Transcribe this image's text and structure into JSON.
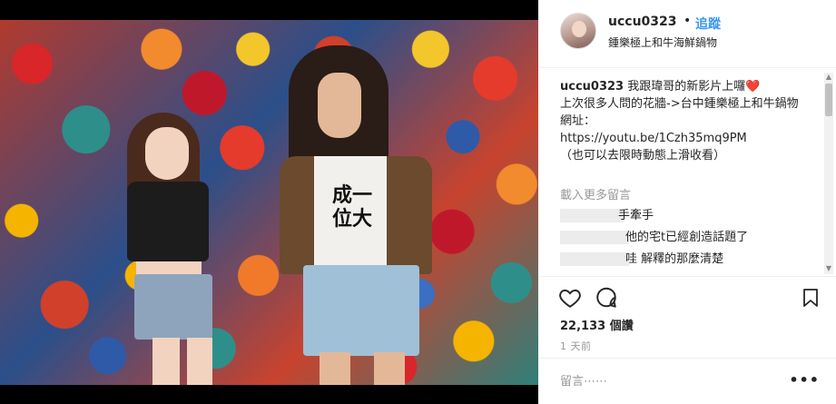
{
  "post": {
    "username": "uccu0323",
    "separator": "•",
    "follow_label": "追蹤",
    "location": "鍾樂極上和牛海鮮鍋物",
    "media": {
      "shirt_text": "成一位大"
    }
  },
  "caption": {
    "username": "uccu0323",
    "text": " 我跟瑋哥的新影片上囉",
    "heart": "❤️",
    "body": "上次很多人問的花牆->台中鍾樂極上和牛鍋物\n網址：\nhttps://youtu.be/1Czh35mq9PM\n（也可以去限時動態上滑收看）"
  },
  "comments": {
    "load_more": "載入更多留言",
    "items": [
      {
        "text": "手牽手"
      },
      {
        "text": "他的宅t已經創造話題了"
      },
      {
        "text": "哇 解釋的那麼清楚"
      }
    ]
  },
  "stats": {
    "likes": "22,133 個讚",
    "time_ago": "1 天前"
  },
  "add_comment": {
    "placeholder": "留言⋯⋯",
    "more_label": "•••"
  },
  "colors": {
    "accent": "#3897f0",
    "text": "#262626",
    "muted": "#999999",
    "border": "#efefef"
  },
  "icons": [
    "heart-outline-icon",
    "comment-icon",
    "bookmark-icon",
    "more-dots-icon"
  ]
}
